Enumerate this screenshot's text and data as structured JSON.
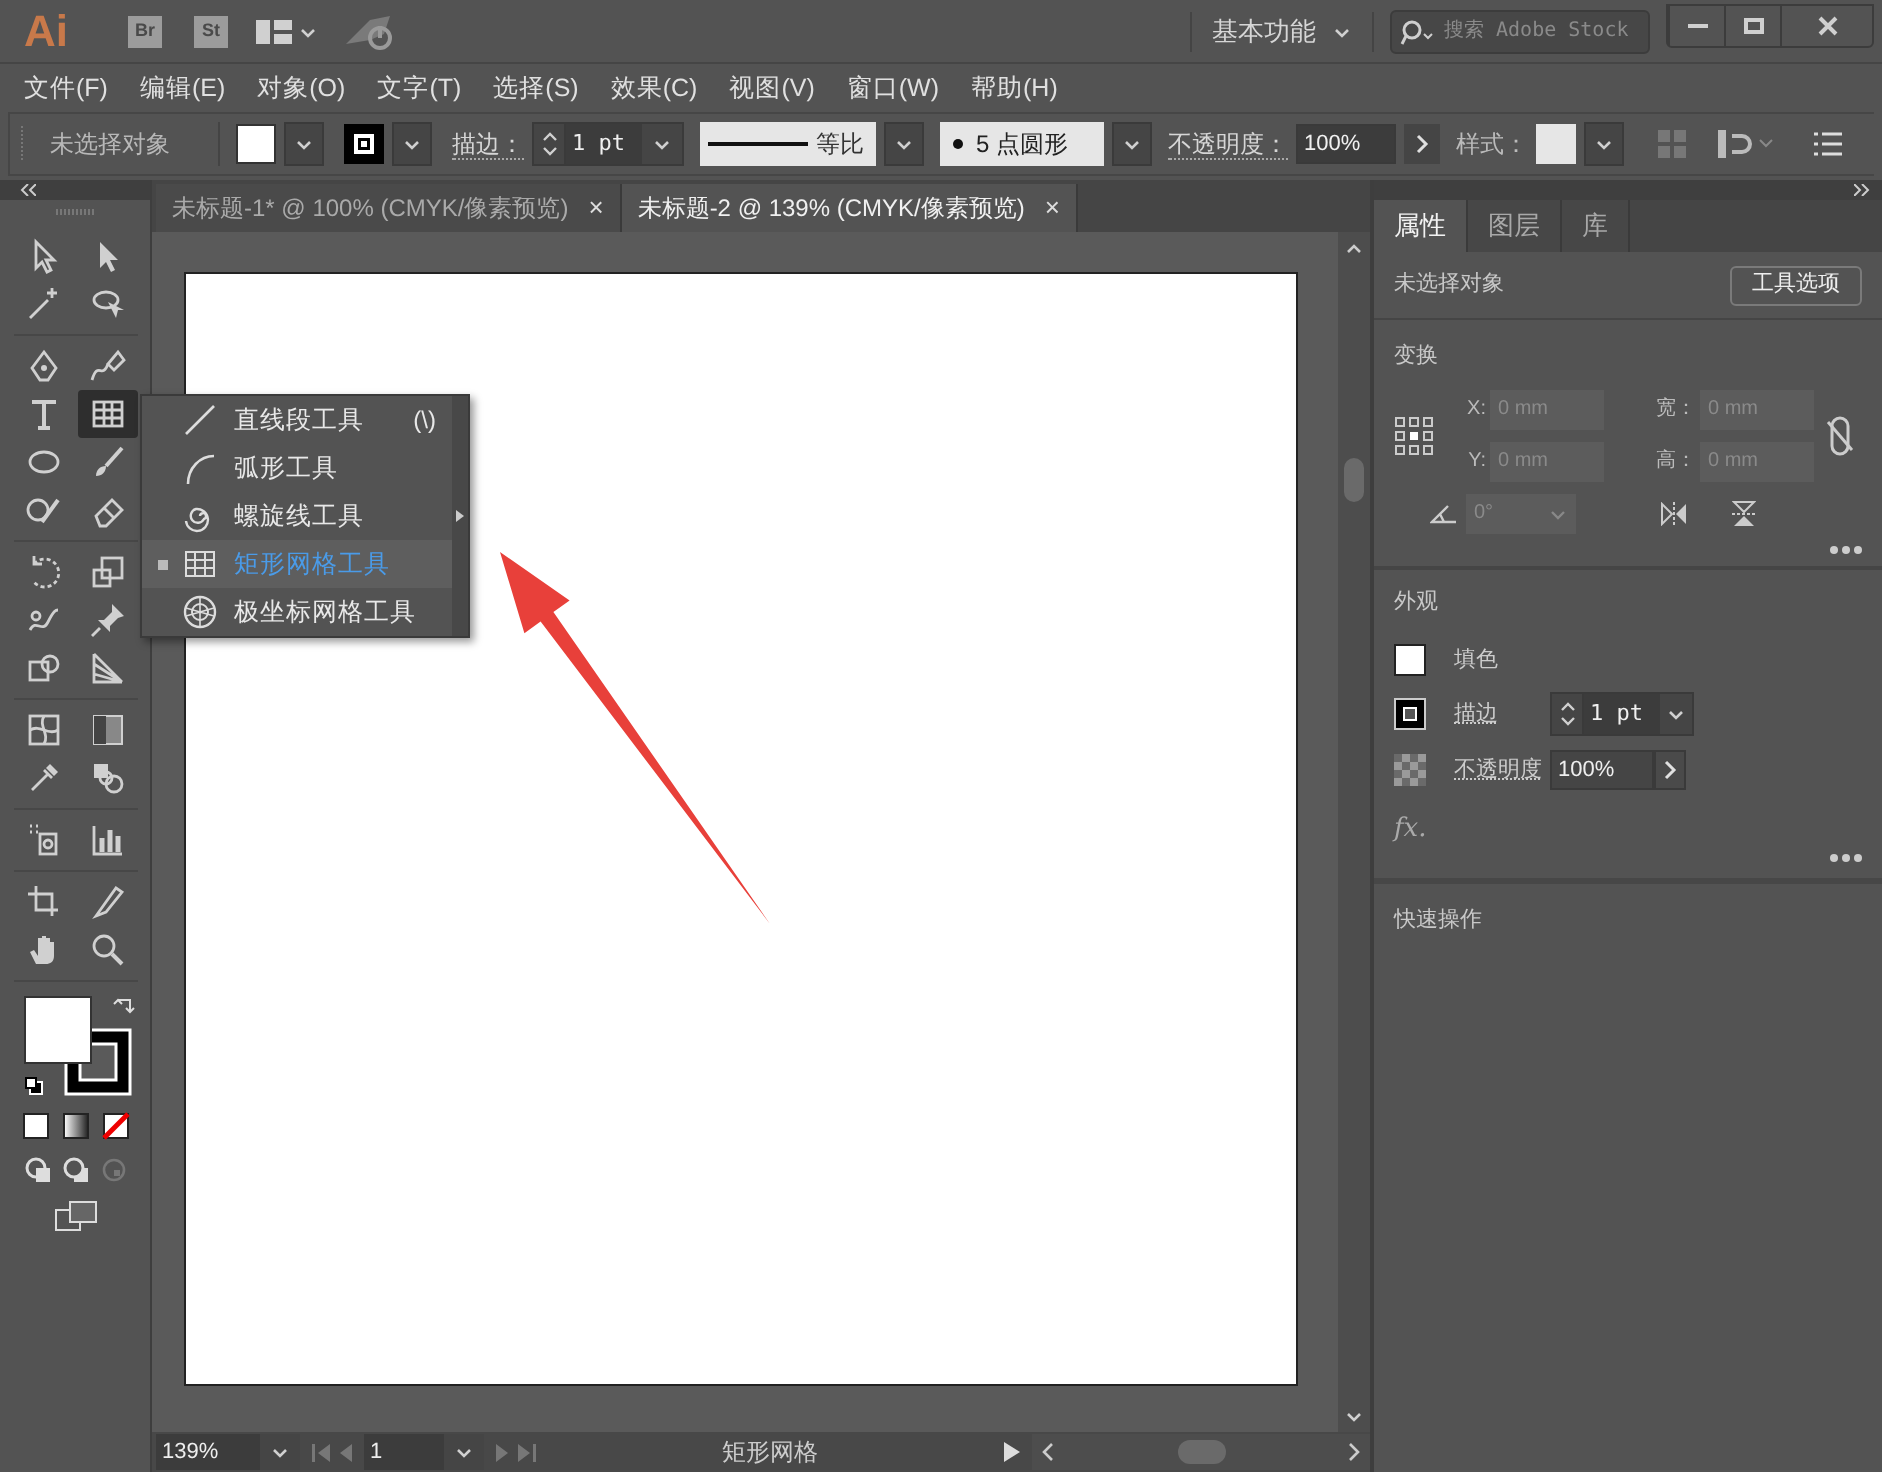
{
  "title_bar": {
    "app_logo": "Ai",
    "apps": [
      "Br",
      "St"
    ],
    "workspace": "基本功能",
    "search": {
      "placeholder": "搜索 Adobe Stock"
    }
  },
  "menu": [
    "文件(F)",
    "编辑(E)",
    "对象(O)",
    "文字(T)",
    "选择(S)",
    "效果(C)",
    "视图(V)",
    "窗口(W)",
    "帮助(H)"
  ],
  "control_bar": {
    "selection": "未选择对象",
    "stroke_label": "描边：",
    "stroke_weight": "1 pt",
    "stroke_profile": "等比",
    "brush": "5 点圆形",
    "opacity_label": "不透明度：",
    "opacity": "100%",
    "style_label": "样式："
  },
  "toolbar": {
    "tools": [
      {
        "selected": false
      },
      {
        "selected": false
      },
      {
        "selected": false
      },
      {
        "selected": false
      },
      {
        "selected": false
      },
      {
        "selected": false
      },
      {
        "selected": false
      },
      {
        "selected": true
      },
      {
        "selected": false
      },
      {
        "selected": false
      },
      {
        "selected": false
      },
      {
        "selected": false
      },
      {
        "selected": false
      },
      {
        "selected": false
      },
      {
        "selected": false
      },
      {
        "selected": false
      },
      {
        "selected": false
      },
      {
        "selected": false
      },
      {
        "selected": false
      },
      {
        "selected": false
      },
      {
        "selected": false
      },
      {
        "selected": false
      },
      {
        "selected": false
      },
      {
        "selected": false
      },
      {
        "selected": false
      },
      {
        "selected": false
      },
      {
        "selected": false
      },
      {
        "selected": false
      }
    ]
  },
  "tool_flyout": {
    "items": [
      {
        "label": "直线段工具",
        "shortcut": "(\\)",
        "selected": false
      },
      {
        "label": "弧形工具",
        "selected": false
      },
      {
        "label": "螺旋线工具",
        "selected": false
      },
      {
        "label": "矩形网格工具",
        "selected": true
      },
      {
        "label": "极坐标网格工具",
        "selected": false
      }
    ]
  },
  "document_tabs": [
    {
      "label": "未标题-1* @ 100% (CMYK/像素预览)",
      "close": "×",
      "selected": false
    },
    {
      "label": "未标题-2 @ 139% (CMYK/像素预览)",
      "close": "×",
      "selected": true
    }
  ],
  "status_bar": {
    "zoom": "139%",
    "artboard": "1",
    "current_tool": "矩形网格"
  },
  "properties_panel": {
    "tabs": [
      {
        "label": "属性",
        "selected": true
      },
      {
        "label": "图层",
        "selected": false
      },
      {
        "label": "库",
        "selected": false
      }
    ],
    "selection": "未选择对象",
    "tool_options_button": "工具选项",
    "transform": {
      "title": "变换",
      "fields": [
        {
          "label": "X:",
          "value": "0 mm",
          "disabled": true
        },
        {
          "label": "宽：",
          "value": "0 mm",
          "disabled": true
        },
        {
          "label": "Y:",
          "value": "0 mm",
          "disabled": true
        },
        {
          "label": "高：",
          "value": "0 mm",
          "disabled": true
        }
      ],
      "angle": {
        "value": "0°",
        "disabled": true
      }
    },
    "appearance": {
      "title": "外观",
      "fill_label": "填色",
      "stroke_label": "描边",
      "stroke_weight": "1 pt",
      "opacity_label": "不透明度",
      "opacity": "100%",
      "fx": "fx."
    },
    "quick_actions": {
      "title": "快速操作"
    }
  }
}
